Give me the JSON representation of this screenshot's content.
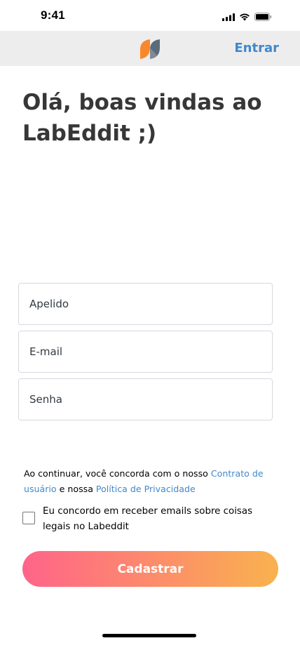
{
  "status_bar": {
    "time": "9:41",
    "icons": [
      "signal-icon",
      "wifi-icon",
      "battery-icon"
    ]
  },
  "header": {
    "logo": "labeddit-logo",
    "login_label": "Entrar",
    "login_color": "#4088CB",
    "background": "#EDEDED"
  },
  "main": {
    "title": "Olá, boas vindas ao LabEddit ;)"
  },
  "form": {
    "nickname_placeholder": "Apelido",
    "email_placeholder": "E-mail",
    "password_placeholder": "Senha"
  },
  "terms": {
    "prefix": "Ao continuar, você concorda com o nosso ",
    "contract_link": "Contrato de usuário",
    "middle": " e nossa ",
    "privacy_link": "Política de Privacidade"
  },
  "newsletter": {
    "label": "Eu concordo em receber emails sobre coisas legais no Labeddit",
    "checked": false
  },
  "signup_button": {
    "label": "Cadastrar",
    "gradient_start": "#FF6489",
    "gradient_end": "#F9B24E"
  }
}
